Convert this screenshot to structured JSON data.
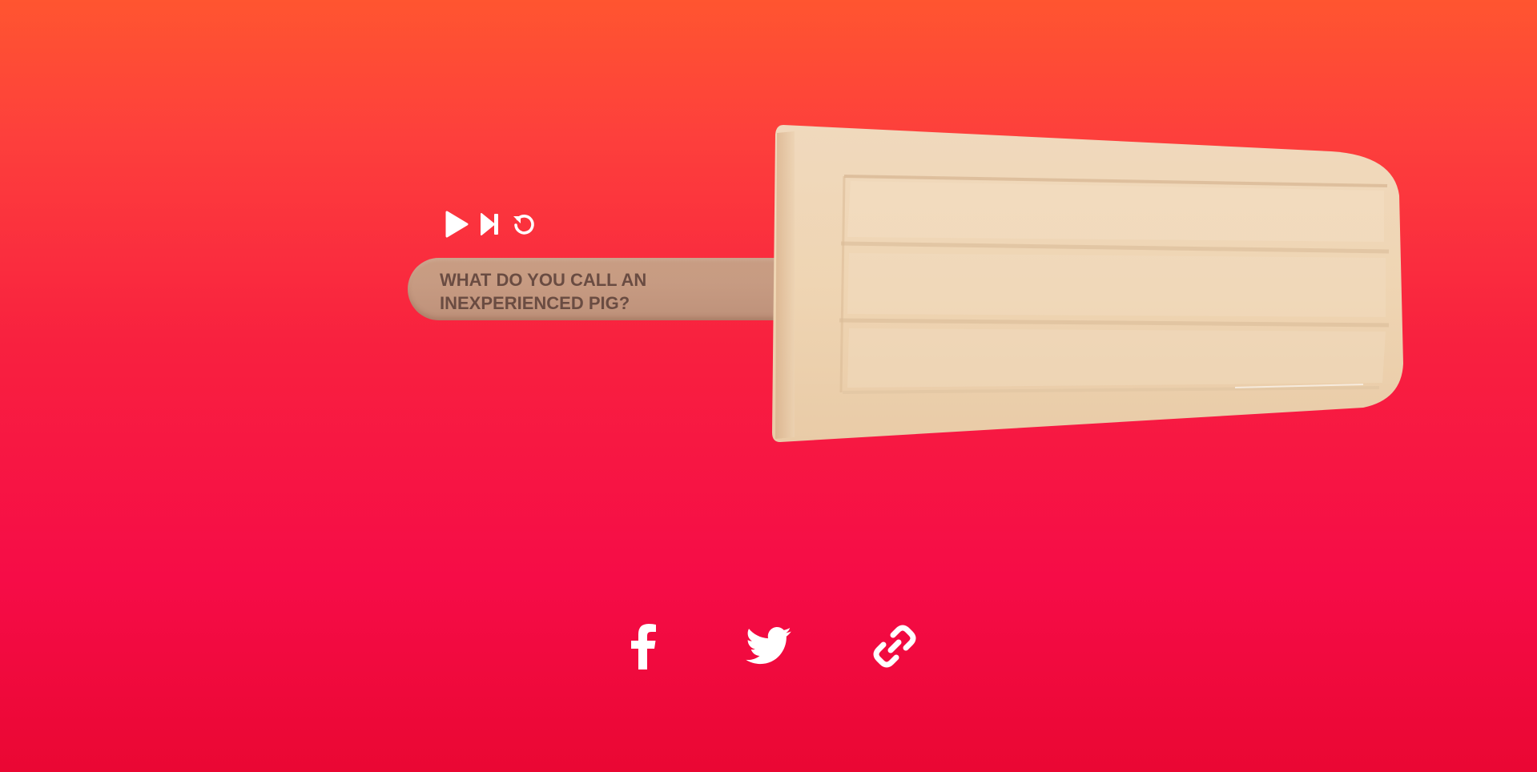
{
  "joke": {
    "lines": [
      "WHAT DO YOU CALL AN",
      "INEXPERIENCED PIG?"
    ]
  },
  "controls": [
    {
      "name": "play",
      "icon": "play-icon"
    },
    {
      "name": "next",
      "icon": "skip-next-icon"
    },
    {
      "name": "replay",
      "icon": "replay-icon"
    }
  ],
  "share": [
    {
      "name": "facebook",
      "icon": "facebook-icon"
    },
    {
      "name": "twitter",
      "icon": "twitter-icon"
    },
    {
      "name": "copy-link",
      "icon": "link-icon"
    }
  ],
  "colors": {
    "background_top": "#ff5530",
    "background_bottom": "#ea0733",
    "stick": "#c79b82",
    "stick_text": "#6a4c42",
    "ice": "#efd4b4",
    "icon": "#ffffff"
  }
}
